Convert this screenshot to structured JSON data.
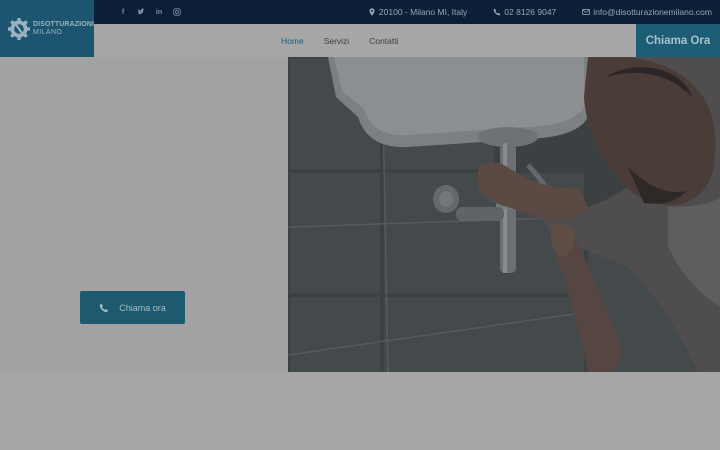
{
  "brand": {
    "name_line1": "DISOTTURAZIONI",
    "name_line2": "MILANO",
    "logo_icon": "gear-wrench-icon"
  },
  "topbar": {
    "social_icons": [
      "facebook-icon",
      "twitter-icon",
      "linkedin-icon",
      "instagram-icon"
    ],
    "address": "20100 - Milano MI, Italy",
    "phone": "02 8126 9047",
    "email": "info@disotturazionemilano.com"
  },
  "nav": {
    "items": [
      {
        "label": "Home",
        "active": true
      },
      {
        "label": "Servizi",
        "active": false
      },
      {
        "label": "Contatti",
        "active": false
      }
    ],
    "cta_label": "Chiama Ora"
  },
  "hero": {
    "button_label": "Chiama ora",
    "button_icon": "phone-icon"
  },
  "colors": {
    "topbar": "#0b1f36",
    "accent": "#1d5e76",
    "overlay_gray": "#a7a7a7"
  }
}
